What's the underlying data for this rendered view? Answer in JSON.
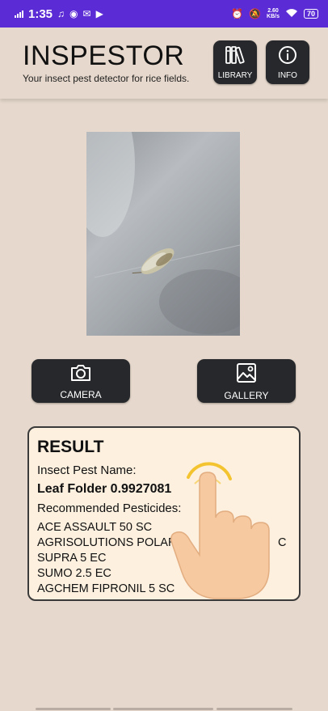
{
  "status_bar": {
    "time": "1:35",
    "net_speed_value": "2.60",
    "net_speed_unit": "KB/s",
    "battery": "70"
  },
  "header": {
    "title": "INSPESTOR",
    "subtitle": "Your insect pest detector for rice fields.",
    "library_label": "LIBRARY",
    "info_label": "INFO"
  },
  "actions": {
    "camera_label": "CAMERA",
    "gallery_label": "GALLERY"
  },
  "result": {
    "title": "RESULT",
    "pest_label": "Insect Pest Name:",
    "pest_value": "Leaf Folder 0.9927081",
    "pesticides_label": "Recommended Pesticides:",
    "pesticides": [
      "ACE ASSAULT 50 SC",
      "AGRISOLUTIONS POLAR",
      "SUPRA 5 EC",
      "SUMO 2.5 EC",
      "AGCHEM FIPRONIL 5 SC"
    ],
    "pesticide_2_tail": "C"
  },
  "colors": {
    "status_bar": "#5b2bd6",
    "background": "#e6d8cc",
    "button": "#26282b",
    "card": "#fdf0df"
  },
  "icons": {
    "library": "library-icon",
    "info": "info-icon",
    "camera": "camera-icon",
    "gallery": "gallery-icon"
  }
}
